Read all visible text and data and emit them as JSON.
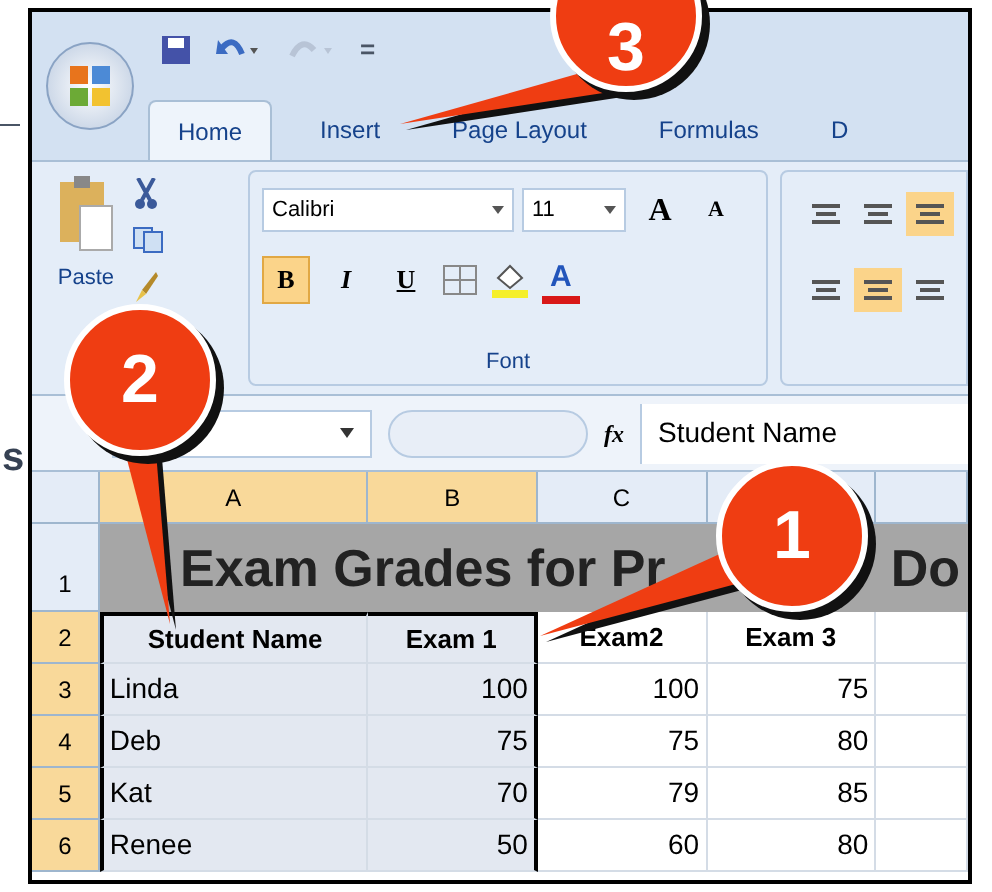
{
  "quick_access": {
    "customize": "="
  },
  "tabs": [
    {
      "label": "Home",
      "selected": true
    },
    {
      "label": "Insert",
      "selected": false
    },
    {
      "label": "Page Layout",
      "selected": false
    },
    {
      "label": "Formulas",
      "selected": false
    },
    {
      "label": "D",
      "selected": false
    }
  ],
  "clipboard": {
    "paste_label": "Paste"
  },
  "font": {
    "name": "Calibri",
    "size": "11",
    "grow": "A",
    "shrink": "A",
    "bold": {
      "label": "B",
      "on": true
    },
    "italic": {
      "label": "I",
      "on": false
    },
    "underline": {
      "label": "U",
      "on": false
    },
    "font_color": "A",
    "group_label": "Font"
  },
  "alignment": [
    {
      "on": false
    },
    {
      "on": false
    },
    {
      "on": true
    },
    {
      "on": false
    },
    {
      "on": true
    },
    {
      "on": false
    }
  ],
  "formula_bar": {
    "fx": "fx",
    "value": "Student Name"
  },
  "columns": [
    {
      "label": "A",
      "selected": true
    },
    {
      "label": "B",
      "selected": true
    },
    {
      "label": "C",
      "selected": false
    }
  ],
  "title_row": {
    "number": "1",
    "text": "Exam Grades for Pr",
    "tail": "Do"
  },
  "rows": [
    {
      "number": "2",
      "selected": true,
      "cells": [
        "Student Name",
        "Exam 1",
        "Exam2",
        "Exam 3"
      ]
    },
    {
      "number": "3",
      "selected": true,
      "cells": [
        "Linda",
        "100",
        "100",
        "75"
      ]
    },
    {
      "number": "4",
      "selected": true,
      "cells": [
        "Deb",
        "75",
        "75",
        "80"
      ]
    },
    {
      "number": "5",
      "selected": true,
      "cells": [
        "Kat",
        "70",
        "79",
        "85"
      ]
    },
    {
      "number": "6",
      "selected": true,
      "cells": [
        "Renee",
        "50",
        "60",
        "80"
      ]
    }
  ],
  "callouts": [
    {
      "number": "3"
    },
    {
      "number": "2"
    },
    {
      "number": "1"
    }
  ],
  "side_text": "s"
}
